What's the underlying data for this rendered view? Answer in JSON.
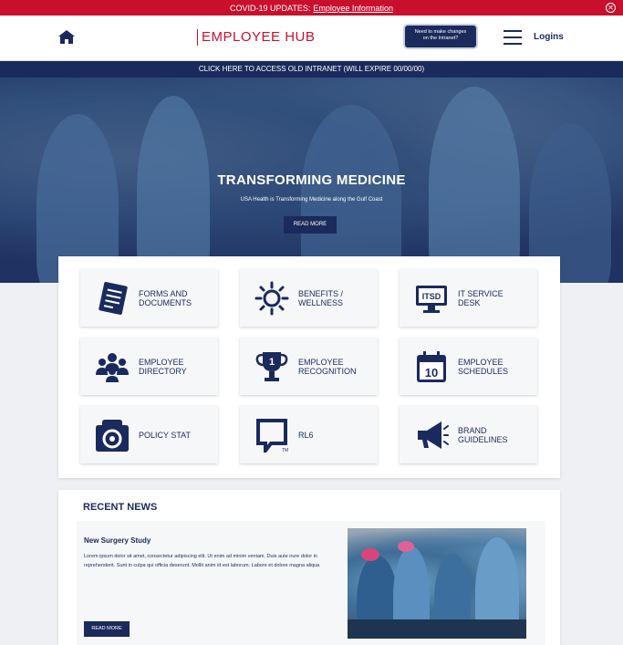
{
  "alert": {
    "prefix": "COVID-19 UPDATES:",
    "link_label": "Employee Information",
    "close_glyph": "✕"
  },
  "header": {
    "logo_text": "EMPLOYEE HUB",
    "change_button_line1": "Need to make changes",
    "change_button_line2": "on the Intranet?",
    "logins_label": "Logins"
  },
  "intranet_bar": {
    "label": "CLICK HERE TO ACCESS OLD INTRANET (WILL EXPIRE 00/00/00)"
  },
  "hero": {
    "title": "TRANSFORMING MEDICINE",
    "subtitle": "USA Health is Transforming Medicine along the Gulf Coast",
    "button_label": "READ MORE"
  },
  "quick_links": [
    {
      "line1": "FORMS AND",
      "line2": "DOCUMENTS",
      "icon": "forms-icon"
    },
    {
      "line1": "BENEFITS /",
      "line2": "WELLNESS",
      "icon": "sun-icon"
    },
    {
      "line1": "IT SERVICE",
      "line2": "DESK",
      "icon": "itsd-monitor-icon",
      "icon_text": "ITSD"
    },
    {
      "line1": "EMPLOYEE",
      "line2": "DIRECTORY",
      "icon": "people-icon"
    },
    {
      "line1": "EMPLOYEE",
      "line2": "RECOGNITION",
      "icon": "trophy-icon",
      "icon_text": "1"
    },
    {
      "line1": "EMPLOYEE",
      "line2": "SCHEDULES",
      "icon": "calendar-icon",
      "icon_text": "10"
    },
    {
      "line1": "POLICY STAT",
      "line2": "",
      "icon": "policystat-icon"
    },
    {
      "line1": "RL6",
      "line2": "",
      "icon": "rl6-icon",
      "icon_text": "TM"
    },
    {
      "line1": "BRAND",
      "line2": "GUIDELINES",
      "icon": "megaphone-icon"
    }
  ],
  "news": {
    "heading": "RECENT NEWS",
    "item_title": "New Surgery Study",
    "item_body": "Lorem ipsum dolor sit amet, consectetur adipiscing elit. Ut enim ad minim veniam. Duis aute irure dolor in reprehenderit. Sunt in culpa qui officia deserunt. Mollit anim id est laborum. Labore et dolore magna aliqua",
    "button_label": "READ MORE"
  },
  "colors": {
    "navy": "#1b2a5c",
    "red": "#c8102e",
    "tile_bg": "#f6f7f9"
  }
}
